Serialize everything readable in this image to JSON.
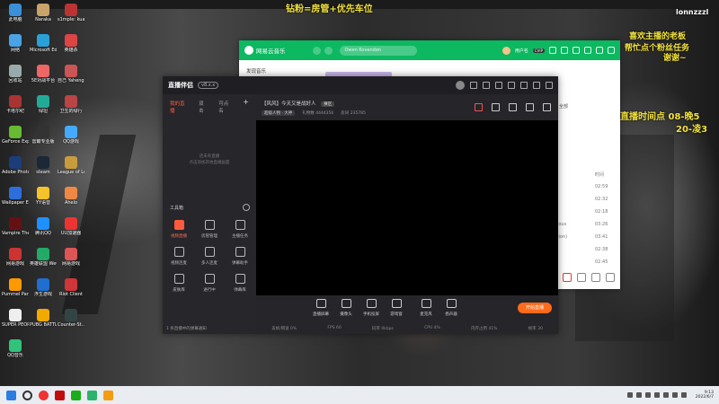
{
  "desktop": {
    "top_banner": "钻粉=房管+优先车位",
    "right_top": "lonnzzzl",
    "right_promo": [
      "喜欢主播的老板",
      "帮忙点个粉丝任务",
      "谢谢~"
    ],
    "right_schedule": [
      "直播时间点 08-晚5",
      "20-凌3"
    ],
    "icons": [
      {
        "label": "此电脑",
        "color": "#3b8fd9"
      },
      {
        "label": "Naraka",
        "color": "#c8a36a"
      },
      {
        "label": "s1mple: kuaiset",
        "color": "#b33"
      },
      {
        "label": "网络",
        "color": "#4aa3e6"
      },
      {
        "label": "Microsoft Edge",
        "color": "#2aa0d8"
      },
      {
        "label": "英雄杀",
        "color": "#d44"
      },
      {
        "label": "回收站",
        "color": "#9aa"
      },
      {
        "label": "5E对战平台",
        "color": "#e66"
      },
      {
        "label": "自己 Yaheng...",
        "color": "#c55"
      },
      {
        "label": "卡塔尔纪",
        "color": "#a33"
      },
      {
        "label": "绿坦",
        "color": "#2a9"
      },
      {
        "label": "卫生的绿行",
        "color": "#b44"
      },
      {
        "label": "GeForce Experience",
        "color": "#6b3"
      },
      {
        "label": "雷霸专业版",
        "color": "#333"
      },
      {
        "label": "QQ游戏",
        "color": "#4af"
      },
      {
        "label": "Adobe Photosho...",
        "color": "#1c3d7a"
      },
      {
        "label": "steam",
        "color": "#1b2838"
      },
      {
        "label": "League of Legends",
        "color": "#c89b3c"
      },
      {
        "label": "Wallpaper Engine",
        "color": "#2d6eda"
      },
      {
        "label": "YY语音",
        "color": "#f6c22b"
      },
      {
        "label": "Ahelo",
        "color": "#e84"
      },
      {
        "label": "Vampire The Masq...",
        "color": "#611"
      },
      {
        "label": "腾讯QQ",
        "color": "#1e90ff"
      },
      {
        "label": "UU加速器",
        "color": "#e33"
      },
      {
        "label": "网易游戏",
        "color": "#c33"
      },
      {
        "label": "英雄联盟 WeGame版",
        "color": "#2a6"
      },
      {
        "label": "网易游戏",
        "color": "#d55"
      },
      {
        "label": "Pummel Party",
        "color": "#f90"
      },
      {
        "label": "浮生游戏",
        "color": "#1e6fd0"
      },
      {
        "label": "Riot Client",
        "color": "#d13639"
      },
      {
        "label": "SUPER PEOPLE CBT",
        "color": "#eee"
      },
      {
        "label": "PUBG BATTLEGR...",
        "color": "#f2a900"
      },
      {
        "label": "Counter-St... Global Offe...",
        "color": "#344"
      },
      {
        "label": "QQ音乐",
        "color": "#31c27c"
      }
    ]
  },
  "netease": {
    "title": "网易云音乐",
    "search_placeholder": "Owen Kovenden",
    "user": "用户名",
    "vip": "CVIP",
    "section": "发现音乐",
    "table_header": "时间",
    "rows": [
      {
        "title": "",
        "time": "02:59"
      },
      {
        "title": "",
        "time": "02:32"
      },
      {
        "title": "",
        "time": "02:18"
      },
      {
        "title": "alt) [Bous",
        "time": "03:26"
      },
      {
        "title": "n Version)",
        "time": "03:41"
      },
      {
        "title": "",
        "time": "02:38"
      },
      {
        "title": "",
        "time": "02:45"
      }
    ],
    "left_text": "全部"
  },
  "live": {
    "brand": "直播伴侣",
    "version": "v8.x.x",
    "tabs": [
      "我的直播",
      "双击",
      "可点名"
    ],
    "empty_text": [
      "还未有直播",
      "点击添加开始直播画面"
    ],
    "tool_title": "工具箱",
    "tools": [
      {
        "label": "视频直播",
        "hot": true
      },
      {
        "label": "房管管理",
        "hot": false
      },
      {
        "label": "主播任务",
        "hot": false
      },
      {
        "label": "视频连麦",
        "hot": false
      },
      {
        "label": "多人连麦",
        "hot": false
      },
      {
        "label": "弹幕助手",
        "hot": false
      },
      {
        "label": "皮肤库",
        "hot": false
      },
      {
        "label": "进行中",
        "hot": false
      },
      {
        "label": "弹幕库",
        "hot": false
      }
    ],
    "footer": "1 条直播中的弹幕通知",
    "room_title": "【风风】今天又是战好人",
    "room_tag": "赛区",
    "meta": [
      "超级人物 · 大神",
      "礼物数 4444356",
      "房间 235785"
    ],
    "bar": [
      {
        "label": "直播屏幕"
      },
      {
        "label": "摄像头"
      },
      {
        "label": "手机投屏"
      },
      {
        "label": "游戏窗"
      },
      {
        "label": "麦克风"
      },
      {
        "label": "扬声器"
      }
    ],
    "go_live": "开始直播",
    "status": [
      "丢帧/网速 0%",
      "FPS 60",
      "码率 0kbps",
      "CPU 4%",
      "内存占用 41%",
      "帧率 30"
    ]
  },
  "taskbar": {
    "time": "9:13",
    "date": "2022/6/7"
  }
}
